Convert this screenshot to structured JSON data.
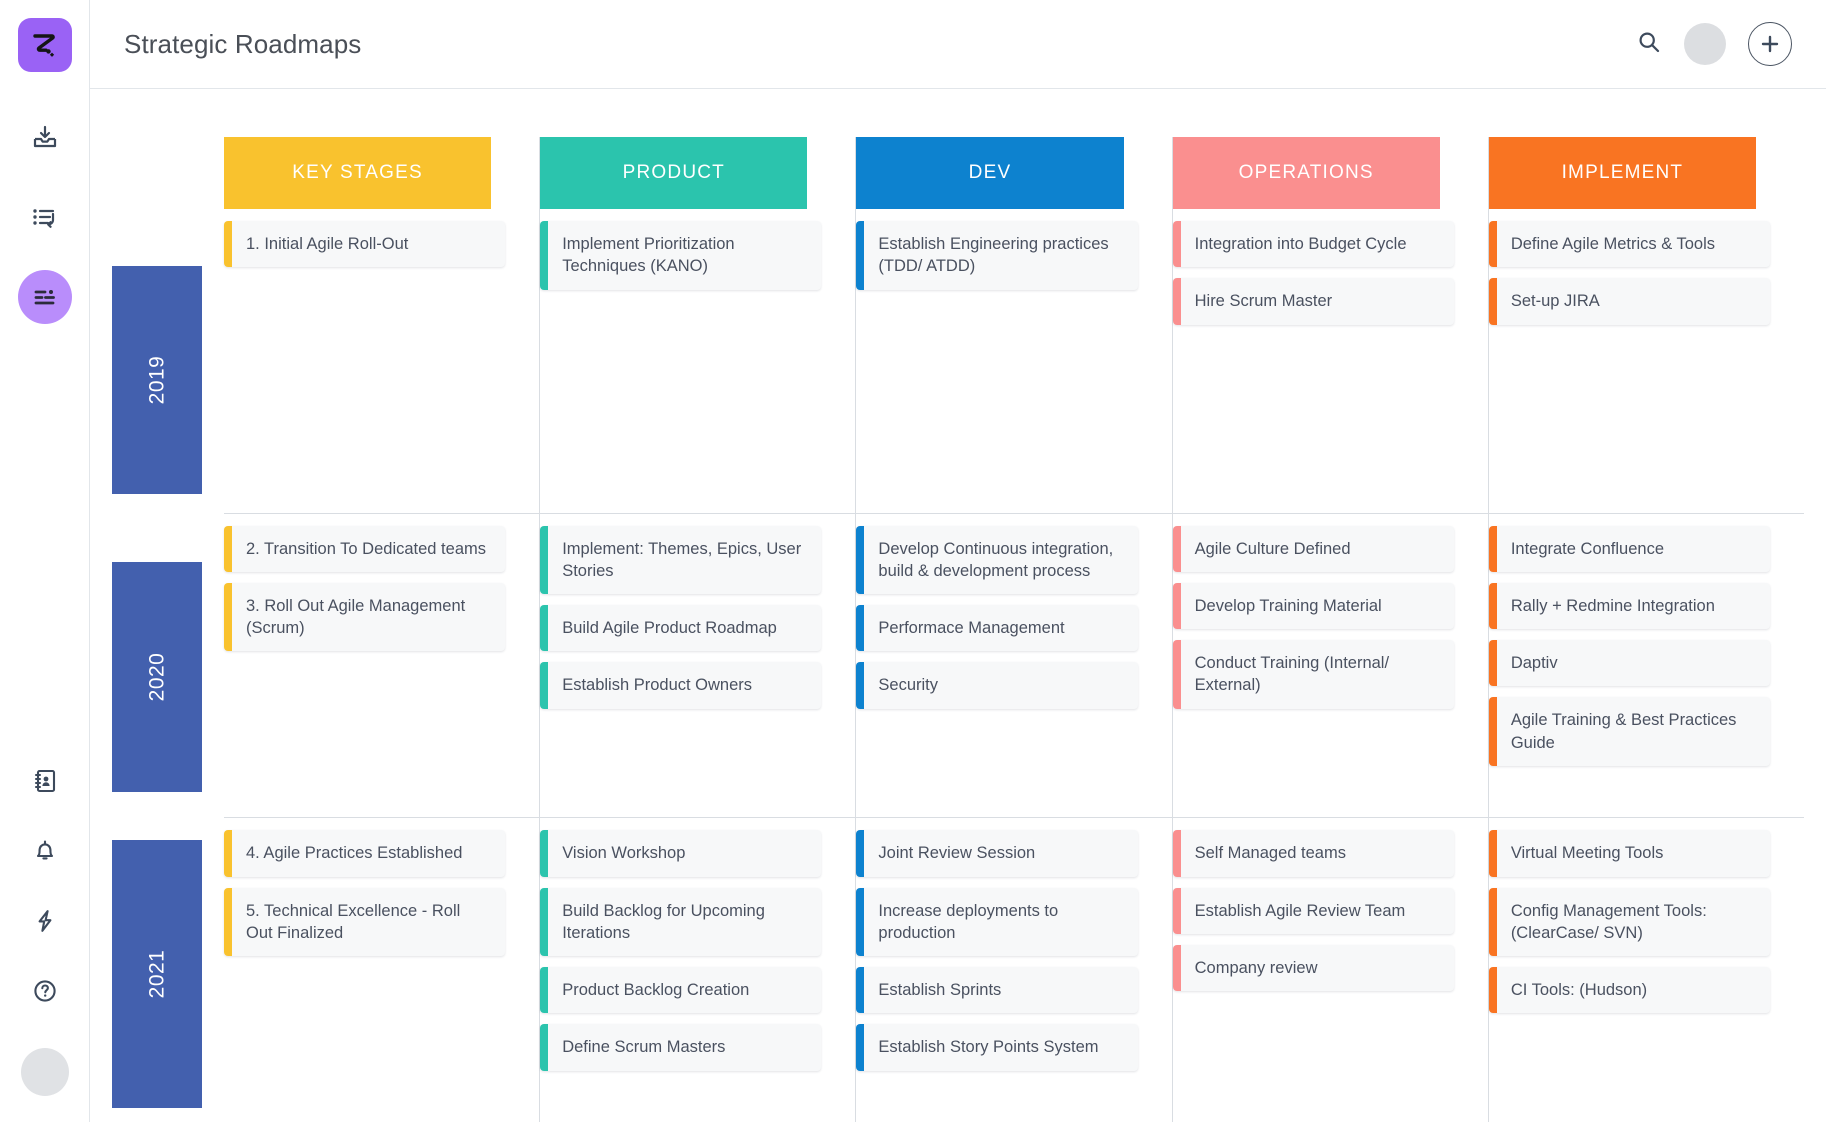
{
  "header": {
    "title": "Strategic Roadmaps",
    "search_icon": "search-icon",
    "avatar": "user-avatar",
    "add_label": "+"
  },
  "sidebar": {
    "logo": "app-logo",
    "items": [
      {
        "icon": "inbox-download-icon",
        "active": false
      },
      {
        "icon": "list-reply-icon",
        "active": false
      },
      {
        "icon": "roadmap-lines-icon",
        "active": true
      }
    ],
    "bottom_items": [
      {
        "icon": "contacts-book-icon"
      },
      {
        "icon": "bell-icon"
      },
      {
        "icon": "lightning-bolt-icon"
      },
      {
        "icon": "help-circle-icon"
      }
    ],
    "avatar": "user-avatar-bottom"
  },
  "board": {
    "columns": [
      {
        "label": "KEY STAGES",
        "color": "#f9c22e"
      },
      {
        "label": "PRODUCT",
        "color": "#2bc4ad"
      },
      {
        "label": "DEV",
        "color": "#0d82cf"
      },
      {
        "label": "OPERATIONS",
        "color": "#fa8f8f"
      },
      {
        "label": "IMPLEMENT",
        "color": "#f97422"
      }
    ],
    "year_color": "#4360ae",
    "rows": [
      {
        "year": "2019",
        "cells": [
          [
            "1. Initial Agile Roll-Out"
          ],
          [
            "Implement Prioritization Techniques (KANO)"
          ],
          [
            "Establish Engineering practices (TDD/ ATDD)"
          ],
          [
            "Integration into Budget Cycle",
            "Hire Scrum Master"
          ],
          [
            "Define Agile Metrics & Tools",
            "Set-up JIRA"
          ]
        ]
      },
      {
        "year": "2020",
        "cells": [
          [
            "2. Transition To Dedicated teams",
            "3. Roll Out Agile Management (Scrum)"
          ],
          [
            "Implement: Themes, Epics, User Stories",
            "Build Agile Product Roadmap",
            "Establish Product Owners"
          ],
          [
            "Develop Continuous integration, build & development process",
            "Performace Management",
            "Security"
          ],
          [
            "Agile Culture Defined",
            "Develop Training Material",
            "Conduct Training (Internal/ External)"
          ],
          [
            "Integrate Confluence",
            "Rally + Redmine Integration",
            "Daptiv",
            "Agile Training & Best Practices Guide"
          ]
        ]
      },
      {
        "year": "2021",
        "cells": [
          [
            "4. Agile Practices Established",
            "5. Technical Excellence - Roll Out Finalized"
          ],
          [
            "Vision Workshop",
            "Build Backlog for Upcoming Iterations",
            "Product Backlog Creation",
            "Define Scrum Masters"
          ],
          [
            "Joint Review Session",
            "Increase deployments to production",
            "Establish Sprints",
            "Establish Story Points System"
          ],
          [
            "Self Managed teams",
            "Establish Agile Review Team",
            "Company review"
          ],
          [
            "Virtual Meeting Tools",
            "Config Management Tools: (ClearCase/ SVN)",
            "CI Tools: (Hudson)"
          ]
        ]
      }
    ]
  }
}
